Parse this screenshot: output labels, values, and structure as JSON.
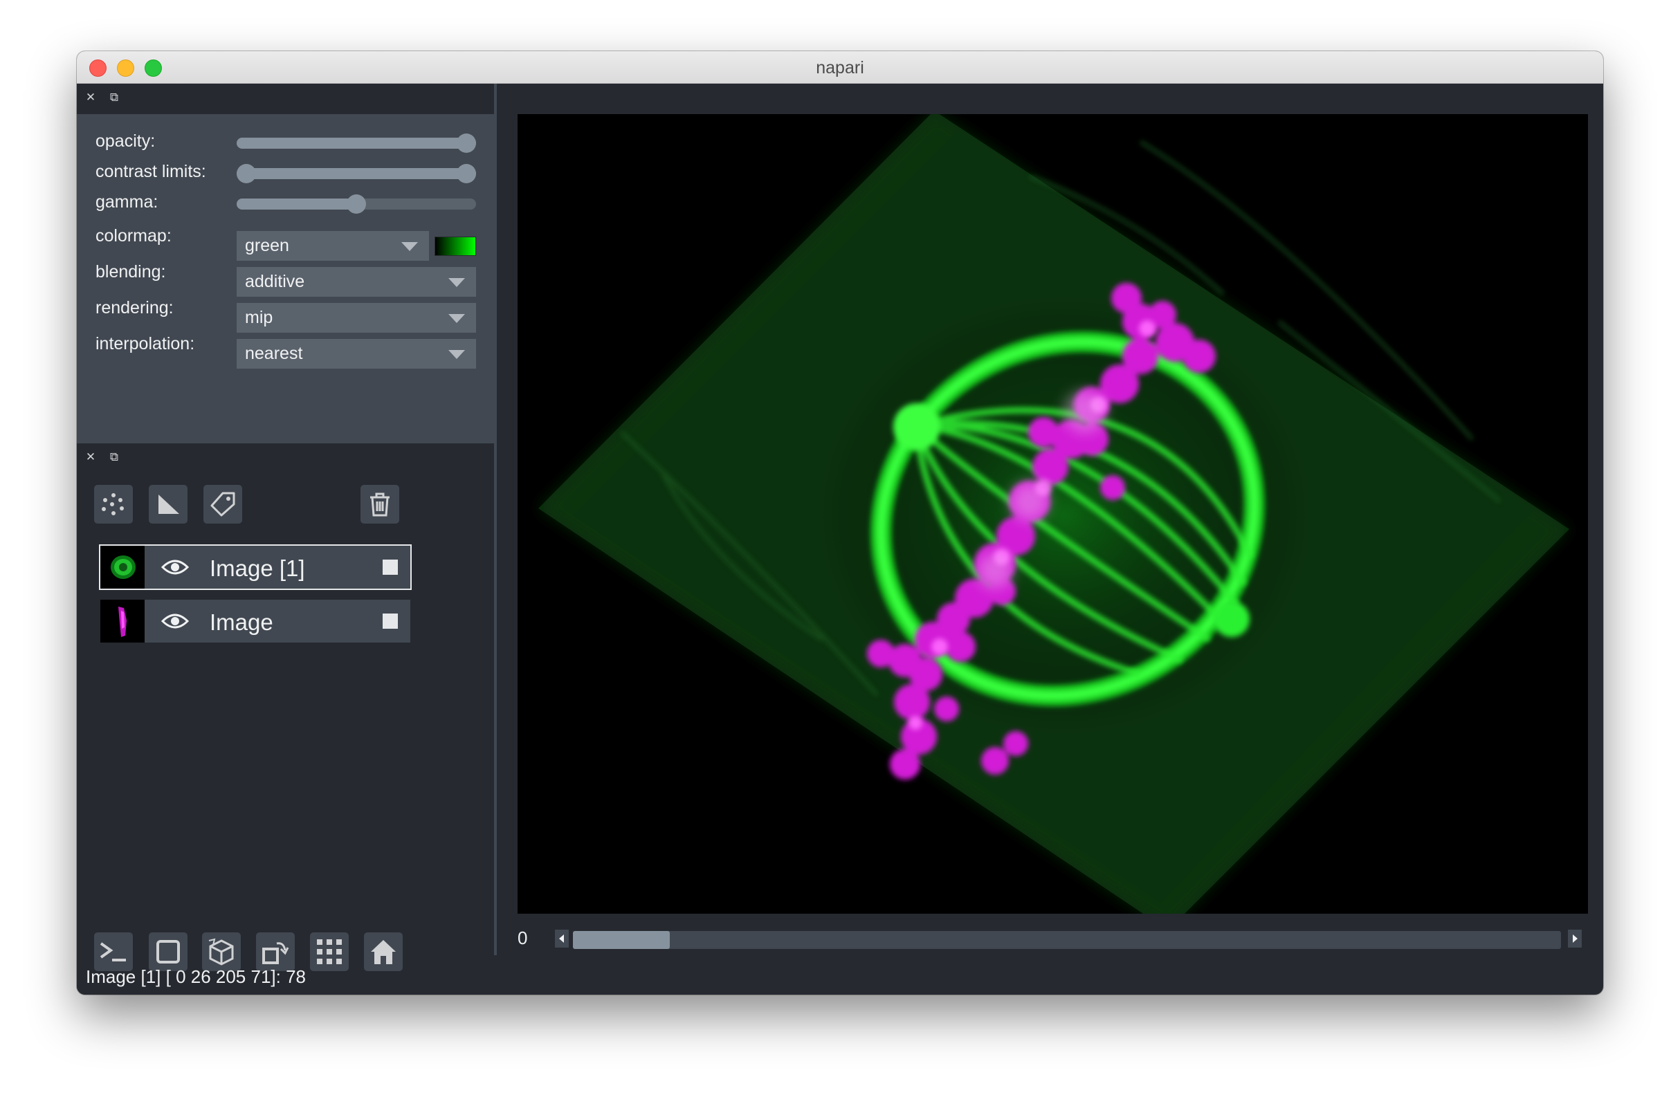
{
  "window": {
    "title": "napari"
  },
  "controls": {
    "opacity_label": "opacity:",
    "opacity_value": 1.0,
    "contrast_label": "contrast limits:",
    "contrast_range": [
      0.0,
      1.0
    ],
    "gamma_label": "gamma:",
    "gamma_value": 0.5,
    "colormap_label": "colormap:",
    "colormap_value": "green",
    "blending_label": "blending:",
    "blending_value": "additive",
    "rendering_label": "rendering:",
    "rendering_value": "mip",
    "interpolation_label": "interpolation:",
    "interpolation_value": "nearest"
  },
  "layers": [
    {
      "name": "Image [1]",
      "selected": true,
      "visible": true,
      "color": "#00ff00"
    },
    {
      "name": "Image",
      "selected": false,
      "visible": true,
      "color": "#ff00ff"
    }
  ],
  "toolbar_icons": [
    "points-icon",
    "shapes-icon",
    "labels-icon",
    "delete-icon"
  ],
  "bottom_icons": [
    "console-icon",
    "2d-view-icon",
    "3d-view-icon",
    "transpose-icon",
    "grid-icon",
    "home-icon"
  ],
  "dims": {
    "label": "0",
    "position_fraction": 0.0
  },
  "status": {
    "text": "Image [1] [  0  26 205  71]: 78"
  },
  "colors": {
    "accent": "#86929d",
    "panel": "#414851",
    "background": "#262930"
  }
}
